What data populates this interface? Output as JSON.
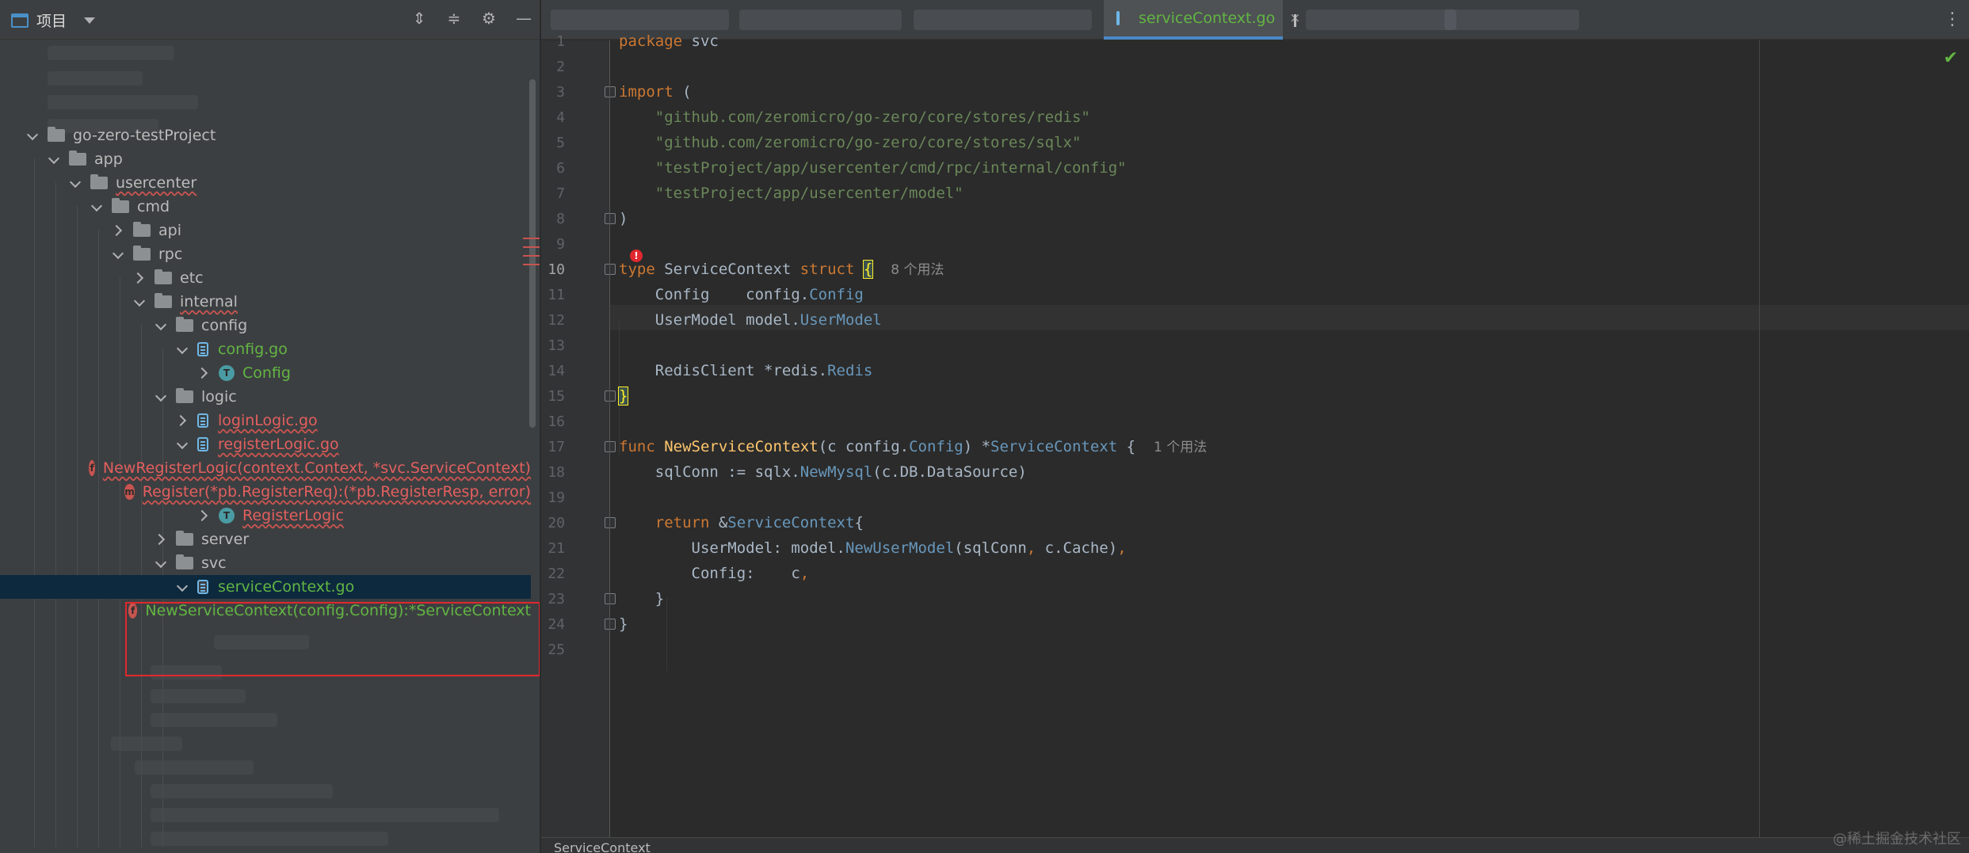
{
  "project_panel": {
    "title": "项目",
    "header_icons": [
      "expand-all-icon",
      "collapse-all-icon",
      "gear-icon",
      "minimize-icon"
    ],
    "tree": [
      {
        "label": "go-zero-testProject",
        "kind": "folder",
        "state": "down",
        "depth": 0,
        "style": "plain"
      },
      {
        "label": "app",
        "kind": "folder",
        "state": "down",
        "depth": 1,
        "style": "plain"
      },
      {
        "label": "usercenter",
        "kind": "folder",
        "state": "down",
        "depth": 2,
        "style": "plain-wavy"
      },
      {
        "label": "cmd",
        "kind": "folder",
        "state": "down",
        "depth": 3,
        "style": "plain"
      },
      {
        "label": "api",
        "kind": "folder",
        "state": "right",
        "depth": 4,
        "style": "plain"
      },
      {
        "label": "rpc",
        "kind": "folder",
        "state": "down",
        "depth": 4,
        "style": "plain"
      },
      {
        "label": "etc",
        "kind": "folder",
        "state": "right",
        "depth": 5,
        "style": "plain"
      },
      {
        "label": "internal",
        "kind": "folder",
        "state": "down",
        "depth": 5,
        "style": "plain-wavy"
      },
      {
        "label": "config",
        "kind": "folder",
        "state": "down",
        "depth": 6,
        "style": "plain"
      },
      {
        "label": "config.go",
        "kind": "gofile",
        "state": "down",
        "depth": 7,
        "style": "green"
      },
      {
        "label": "Config",
        "kind": "type",
        "state": "right",
        "depth": 8,
        "style": "green"
      },
      {
        "label": "logic",
        "kind": "folder",
        "state": "down",
        "depth": 6,
        "style": "plain"
      },
      {
        "label": "loginLogic.go",
        "kind": "gofile",
        "state": "right",
        "depth": 7,
        "style": "red"
      },
      {
        "label": "registerLogic.go",
        "kind": "gofile",
        "state": "down",
        "depth": 7,
        "style": "red"
      },
      {
        "label": "NewRegisterLogic(context.Context, *svc.ServiceContext)",
        "kind": "func",
        "state": "none",
        "depth": 8,
        "style": "red"
      },
      {
        "label": "Register(*pb.RegisterReq):(*pb.RegisterResp, error)",
        "kind": "method",
        "state": "none",
        "depth": 8,
        "style": "red"
      },
      {
        "label": "RegisterLogic",
        "kind": "type",
        "state": "right",
        "depth": 8,
        "style": "red"
      },
      {
        "label": "server",
        "kind": "folder",
        "state": "right",
        "depth": 6,
        "style": "plain"
      },
      {
        "label": "svc",
        "kind": "folder",
        "state": "down",
        "depth": 6,
        "style": "plain"
      },
      {
        "label": "serviceContext.go",
        "kind": "gofile",
        "state": "down",
        "depth": 7,
        "style": "green",
        "selected": true
      },
      {
        "label": "NewServiceContext(config.Config):*ServiceContext",
        "kind": "func",
        "state": "none",
        "depth": 8,
        "style": "green"
      }
    ]
  },
  "editor": {
    "active_tab": "serviceContext.go",
    "close_glyph": "×",
    "more_glyph": "⋮",
    "check_glyph": "✔",
    "breadcrumb": "ServiceContext",
    "watermark": "@稀土掘金技术社区",
    "current_line": 10,
    "lines": [
      {
        "n": 1,
        "tokens": [
          [
            "kw",
            "package"
          ],
          [
            "",
            " svc"
          ]
        ]
      },
      {
        "n": 2,
        "tokens": []
      },
      {
        "n": 3,
        "tokens": [
          [
            "kw",
            "import"
          ],
          [
            "",
            " ("
          ]
        ],
        "fold": true
      },
      {
        "n": 4,
        "tokens": [
          [
            "",
            "    "
          ],
          [
            "str",
            "\"github.com/zeromicro/go-zero/core/stores/redis\""
          ]
        ]
      },
      {
        "n": 5,
        "tokens": [
          [
            "",
            "    "
          ],
          [
            "str",
            "\"github.com/zeromicro/go-zero/core/stores/sqlx\""
          ]
        ]
      },
      {
        "n": 6,
        "tokens": [
          [
            "",
            "    "
          ],
          [
            "str",
            "\"testProject/app/usercenter/cmd/rpc/internal/config\""
          ]
        ]
      },
      {
        "n": 7,
        "tokens": [
          [
            "",
            "    "
          ],
          [
            "str",
            "\"testProject/app/usercenter/model\""
          ]
        ]
      },
      {
        "n": 8,
        "tokens": [
          [
            "",
            ")"
          ]
        ],
        "fold": true
      },
      {
        "n": 9,
        "tokens": []
      },
      {
        "n": 10,
        "tokens": [
          [
            "kw",
            "type"
          ],
          [
            "",
            " ServiceContext "
          ],
          [
            "kw",
            "struct"
          ],
          [
            "",
            " "
          ],
          [
            "brace-hl",
            "{"
          ],
          [
            "",
            "  "
          ],
          [
            "hint",
            "8 个用法"
          ]
        ],
        "fold": true
      },
      {
        "n": 11,
        "tokens": [
          [
            "",
            "    Config    config."
          ],
          [
            "typ",
            "Config"
          ]
        ]
      },
      {
        "n": 12,
        "tokens": [
          [
            "",
            "    UserModel model."
          ],
          [
            "typ",
            "UserModel"
          ]
        ]
      },
      {
        "n": 13,
        "tokens": []
      },
      {
        "n": 14,
        "tokens": [
          [
            "",
            "    RedisClient *redis."
          ],
          [
            "typ",
            "Redis"
          ]
        ]
      },
      {
        "n": 15,
        "tokens": [
          [
            "brace-hl",
            "}"
          ]
        ],
        "fold": true
      },
      {
        "n": 16,
        "tokens": []
      },
      {
        "n": 17,
        "tokens": [
          [
            "kw",
            "func"
          ],
          [
            "",
            " "
          ],
          [
            "fn",
            "NewServiceContext"
          ],
          [
            "",
            "(c config."
          ],
          [
            "typ",
            "Config"
          ],
          [
            "",
            ") *"
          ],
          [
            "typ",
            "ServiceContext"
          ],
          [
            "",
            " {  "
          ],
          [
            "hint",
            "1 个用法"
          ]
        ],
        "fold": true
      },
      {
        "n": 18,
        "tokens": [
          [
            "",
            "    sqlConn := sqlx."
          ],
          [
            "typ",
            "NewMysql"
          ],
          [
            "",
            "(c.DB.DataSource)"
          ]
        ]
      },
      {
        "n": 19,
        "tokens": []
      },
      {
        "n": 20,
        "tokens": [
          [
            "",
            "    "
          ],
          [
            "kw",
            "return"
          ],
          [
            "",
            " &"
          ],
          [
            "typ",
            "ServiceContext"
          ],
          [
            "",
            "{"
          ]
        ],
        "fold": true
      },
      {
        "n": 21,
        "tokens": [
          [
            "",
            "        UserModel: model."
          ],
          [
            "typ",
            "NewUserModel"
          ],
          [
            "",
            "(sqlConn"
          ],
          [
            "kw",
            ","
          ],
          [
            "",
            " c.Cache)"
          ],
          [
            "kw",
            ","
          ]
        ]
      },
      {
        "n": 22,
        "tokens": [
          [
            "",
            "        Config:    c"
          ],
          [
            "kw",
            ","
          ]
        ]
      },
      {
        "n": 23,
        "tokens": [
          [
            "",
            "    }"
          ]
        ],
        "fold": true
      },
      {
        "n": 24,
        "tokens": [
          [
            "",
            "}"
          ]
        ],
        "fold": true
      },
      {
        "n": 25,
        "tokens": []
      }
    ]
  }
}
